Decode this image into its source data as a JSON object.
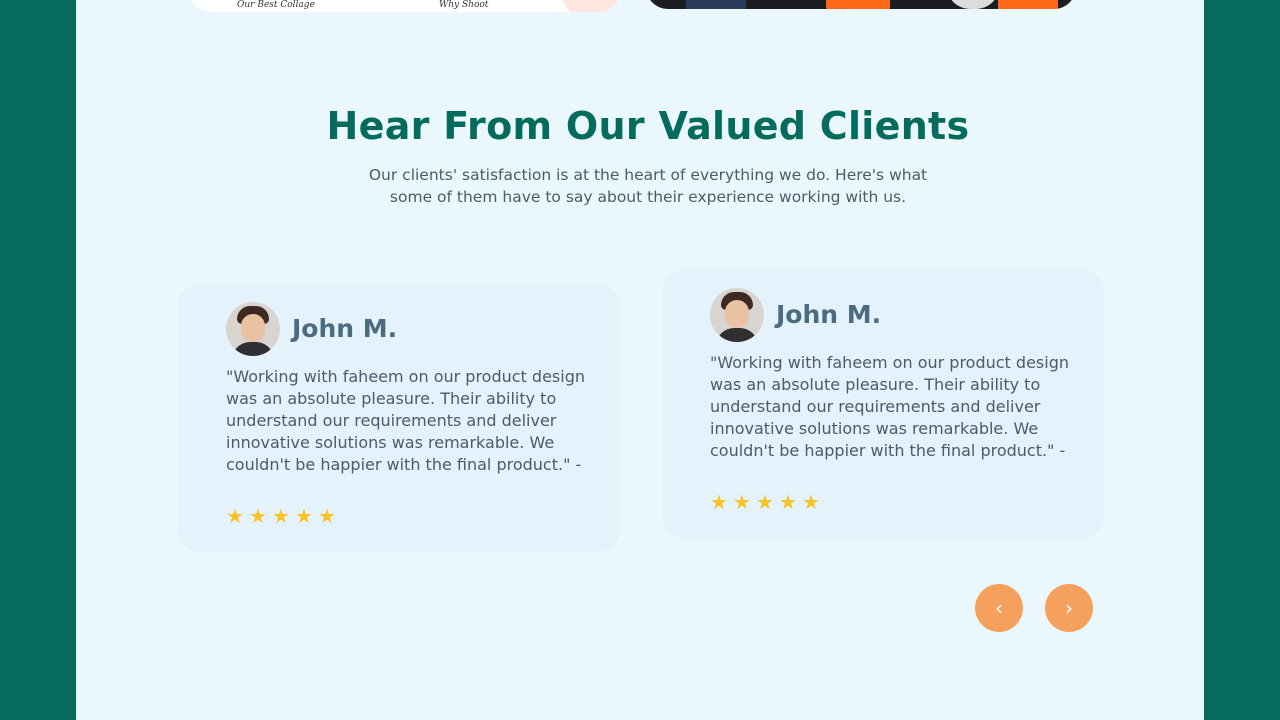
{
  "colors": {
    "frame": "#046b5d",
    "page_bg": "#eaf7fd",
    "title": "#046b5d",
    "name": "#4c6a80",
    "star": "#f7c325",
    "nav_button": "#f5a15d"
  },
  "top_cards": {
    "left_scribble_1": "Our Best Collage",
    "left_scribble_2": "Why Shoot"
  },
  "section": {
    "title": "Hear From Our Valued Clients",
    "subtitle": "Our clients' satisfaction is at the heart of everything we do. Here's what some of them have to say about their experience working with us."
  },
  "testimonials": [
    {
      "name": "John M.",
      "quote": "\"Working with faheem on our product design was an absolute pleasure. Their ability to understand our requirements and deliver innovative solutions was remarkable. We couldn't be happier with the final product.\" -",
      "rating": 5,
      "rating_max": 5
    },
    {
      "name": "John M.",
      "quote": "\"Working with faheem on our product design was an absolute pleasure. Their ability to understand our requirements and deliver innovative solutions was remarkable. We couldn't be happier with the final product.\" -",
      "rating": 5,
      "rating_max": 5
    }
  ],
  "navigation": {
    "prev_icon": "chevron-left-icon",
    "next_icon": "chevron-right-icon",
    "prev_glyph": "‹",
    "next_glyph": "›"
  }
}
